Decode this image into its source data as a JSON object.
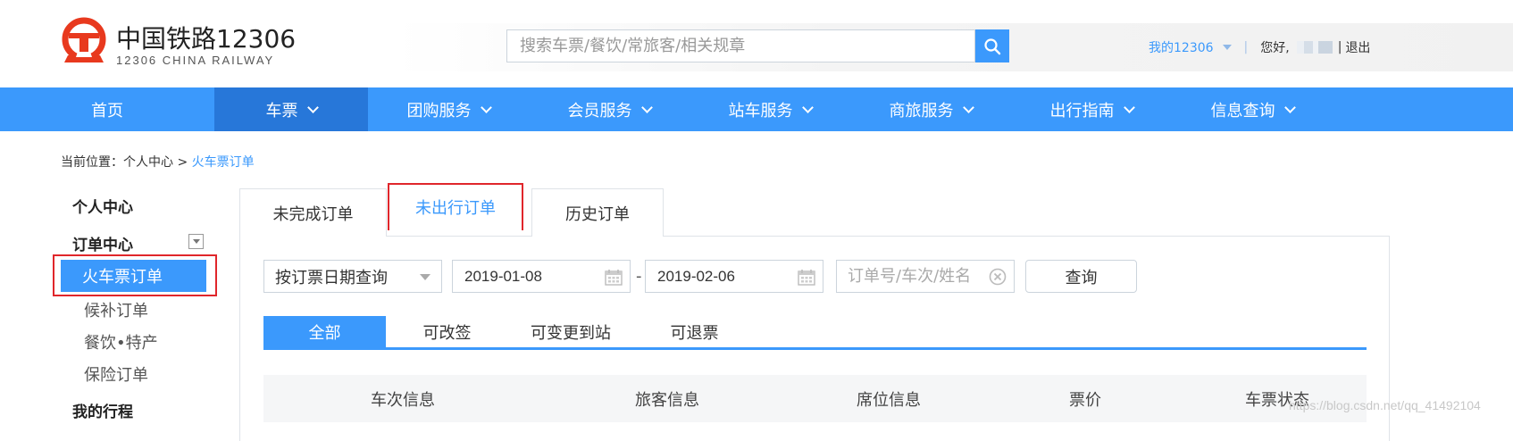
{
  "header": {
    "logo_cn": "中国铁路12306",
    "logo_en": "12306 CHINA RAILWAY",
    "search_placeholder": "搜索车票/餐饮/常旅客/相关规章",
    "my12306": "我的12306",
    "separator": "|",
    "greeting": "您好,",
    "logout_separator": "|",
    "logout": "退出"
  },
  "nav": {
    "items": [
      {
        "label": "首页"
      },
      {
        "label": "车票"
      },
      {
        "label": "团购服务"
      },
      {
        "label": "会员服务"
      },
      {
        "label": "站车服务"
      },
      {
        "label": "商旅服务"
      },
      {
        "label": "出行指南"
      },
      {
        "label": "信息查询"
      }
    ],
    "active_index": 1
  },
  "breadcrumb": {
    "prefix": "当前位置：",
    "root": "个人中心",
    "sep": " > ",
    "current": "火车票订单"
  },
  "sidebar": {
    "personal_center": "个人中心",
    "order_center": "订单中心",
    "items": [
      {
        "label": "火车票订单",
        "active": true
      },
      {
        "label": "候补订单"
      },
      {
        "label": "餐饮•特产"
      },
      {
        "label": "保险订单"
      }
    ],
    "my_trips": "我的行程"
  },
  "tabs": [
    {
      "label": "未完成订单"
    },
    {
      "label": "未出行订单",
      "active": true
    },
    {
      "label": "历史订单"
    }
  ],
  "filter": {
    "query_type": "按订票日期查询",
    "date_from": "2019-01-08",
    "date_sep": "-",
    "date_to": "2019-02-06",
    "keyword_placeholder": "订单号/车次/姓名",
    "query_button": "查询"
  },
  "subtabs": [
    {
      "label": "全部",
      "active": true
    },
    {
      "label": "可改签"
    },
    {
      "label": "可变更到站"
    },
    {
      "label": "可退票"
    }
  ],
  "table": {
    "columns": [
      "车次信息",
      "旅客信息",
      "席位信息",
      "票价",
      "车票状态"
    ]
  },
  "watermark": "https://blog.csdn.net/qq_41492104",
  "colors": {
    "brand_blue": "#3b99fc",
    "nav_active": "#2777d9",
    "highlight_red": "#e0262b",
    "logo_red": "#e8391e"
  },
  "icons": {
    "search": "search-icon",
    "calendar": "calendar-icon",
    "clear": "clear-icon",
    "dropdown": "chevron-down-icon"
  }
}
